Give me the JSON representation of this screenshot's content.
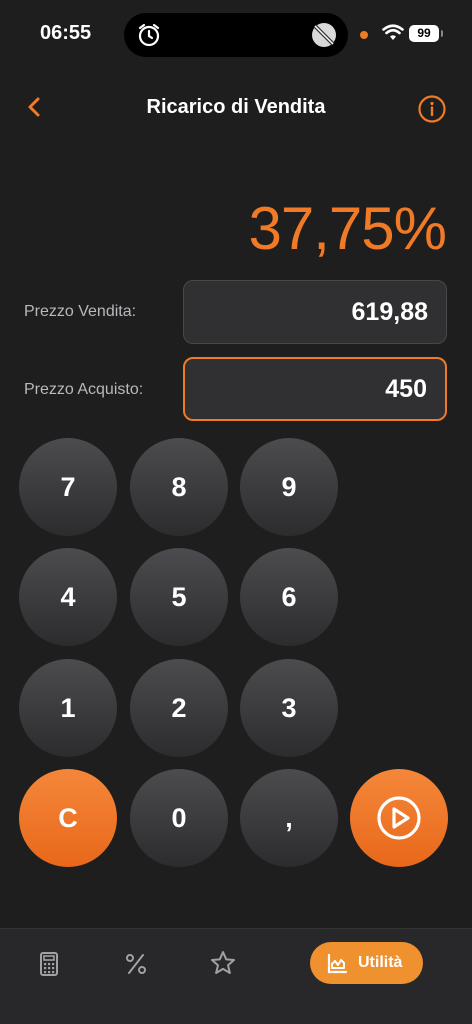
{
  "status_bar": {
    "time": "06:55",
    "battery": "99"
  },
  "nav": {
    "title": "Ricarico di Vendita"
  },
  "result": "37,75%",
  "fields": {
    "sale_label": "Prezzo Vendita:",
    "sale_value": "619,88",
    "purchase_label": "Prezzo Acquisto:",
    "purchase_value": "450"
  },
  "keypad": {
    "k7": "7",
    "k8": "8",
    "k9": "9",
    "k4": "4",
    "k5": "5",
    "k6": "6",
    "k1": "1",
    "k2": "2",
    "k3": "3",
    "clear": "C",
    "k0": "0",
    "comma": ","
  },
  "tab_bar": {
    "items": [
      "calculator-icon",
      "percent-icon",
      "star-icon"
    ],
    "active_label": "Utilità"
  },
  "colors": {
    "accent": "#f07a26",
    "background": "#1e1e1f"
  }
}
